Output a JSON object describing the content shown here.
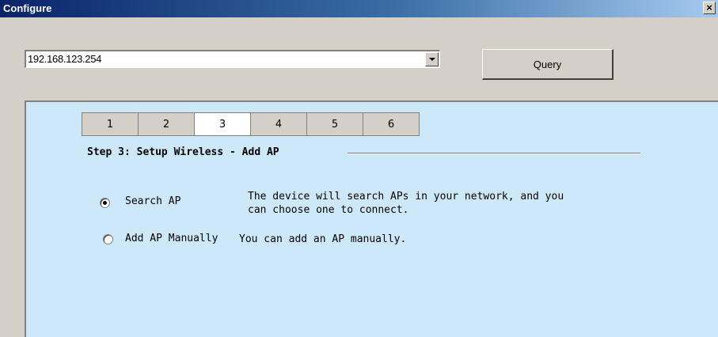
{
  "window": {
    "title": "Configure",
    "close_glyph": "×"
  },
  "address": {
    "value": "192.168.123.254"
  },
  "query_button": {
    "label": "Query"
  },
  "tabs": [
    {
      "label": "1",
      "active": false
    },
    {
      "label": "2",
      "active": false
    },
    {
      "label": "3",
      "active": true
    },
    {
      "label": "4",
      "active": false
    },
    {
      "label": "5",
      "active": false
    },
    {
      "label": "6",
      "active": false
    }
  ],
  "step": {
    "heading": "Step 3: Setup Wireless - Add AP"
  },
  "options": [
    {
      "label": "Search AP",
      "selected": true,
      "description_line1": "The device will search APs in your network, and you",
      "description_line2": "can choose one to connect."
    },
    {
      "label": "Add AP Manually",
      "selected": false,
      "description_line1": "You can add an AP manually."
    }
  ],
  "colors": {
    "panel_background": "#cce8f9",
    "window_face": "#d4d0c8",
    "titlebar_start": "#0a246a",
    "titlebar_end": "#a6caf0"
  }
}
